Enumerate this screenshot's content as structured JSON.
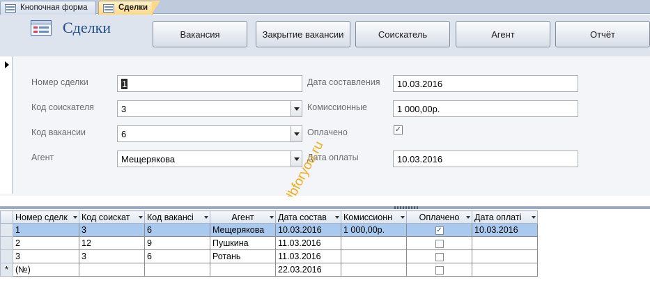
{
  "tabs": [
    {
      "label": "Кнопочная форма",
      "active": false
    },
    {
      "label": "Сделки",
      "active": true
    }
  ],
  "header": {
    "title": "Сделки",
    "buttons": [
      "Вакансия",
      "Закрытие вакансии",
      "Соискатель",
      "Агент",
      "Отчёт"
    ]
  },
  "form": {
    "deal_number": {
      "label": "Номер сделки",
      "value": "1"
    },
    "applicant_code": {
      "label": "Код соискателя",
      "value": "3"
    },
    "vacancy_code": {
      "label": "Код вакансии",
      "value": "6"
    },
    "agent": {
      "label": "Агент",
      "value": "Мещерякова"
    },
    "date_created": {
      "label": "Дата составления",
      "value": "10.03.2016"
    },
    "commission": {
      "label": "Комиссионные",
      "value": "1 000,00р."
    },
    "paid": {
      "label": "Оплачено",
      "checked": true
    },
    "pay_date": {
      "label": "Дата оплаты",
      "value": "10.03.2016"
    }
  },
  "watermark": "dbforyou.ru",
  "grid": {
    "columns": [
      "Номер сделк",
      "Код соискат",
      "Код вакансі",
      "Агент",
      "Дата состав",
      "Комиссионн",
      "Оплачено",
      "Дата оплаті"
    ],
    "rows": [
      {
        "num": "1",
        "applicant": "3",
        "vacancy": "6",
        "agent": "Мещерякова",
        "date": "10.03.2016",
        "commission": "1 000,00р.",
        "paid": true,
        "pay_date": "10.03.2016"
      },
      {
        "num": "2",
        "applicant": "12",
        "vacancy": "9",
        "agent": "Пушкина",
        "date": "11.03.2016",
        "commission": "",
        "paid": false,
        "pay_date": ""
      },
      {
        "num": "3",
        "applicant": "3",
        "vacancy": "6",
        "agent": "Ротань",
        "date": "11.03.2016",
        "commission": "",
        "paid": false,
        "pay_date": ""
      }
    ],
    "new_row": {
      "marker": "*",
      "num": "(№)",
      "date": "22.03.2016"
    }
  },
  "colors": {
    "accent_tab": "#fbd88a",
    "header_bg": "#dde4ee",
    "title": "#1f4e8c",
    "current_row": "#a9c9ef"
  }
}
